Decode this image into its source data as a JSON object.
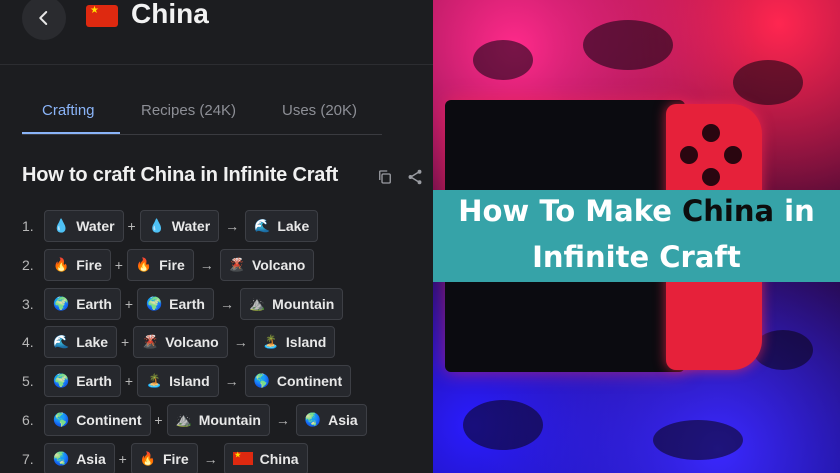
{
  "header": {
    "title": "China",
    "back_icon": "chevron-left-icon"
  },
  "tabs": [
    {
      "label": "Crafting",
      "active": true
    },
    {
      "label": "Recipes (24K)",
      "active": false
    },
    {
      "label": "Uses (20K)",
      "active": false
    }
  ],
  "section": {
    "heading": "How to craft China in Infinite Craft",
    "copy_icon": "copy-icon",
    "share_icon": "share-icon"
  },
  "steps": [
    {
      "num": "1.",
      "a": {
        "emoji": "💧",
        "label": "Water"
      },
      "b": {
        "emoji": "💧",
        "label": "Water"
      },
      "result": {
        "emoji": "🌊",
        "label": "Lake"
      }
    },
    {
      "num": "2.",
      "a": {
        "emoji": "🔥",
        "label": "Fire"
      },
      "b": {
        "emoji": "🔥",
        "label": "Fire"
      },
      "result": {
        "emoji": "🌋",
        "label": "Volcano"
      }
    },
    {
      "num": "3.",
      "a": {
        "emoji": "🌍",
        "label": "Earth"
      },
      "b": {
        "emoji": "🌍",
        "label": "Earth"
      },
      "result": {
        "emoji": "⛰️",
        "label": "Mountain"
      }
    },
    {
      "num": "4.",
      "a": {
        "emoji": "🌊",
        "label": "Lake"
      },
      "b": {
        "emoji": "🌋",
        "label": "Volcano"
      },
      "result": {
        "emoji": "🏝️",
        "label": "Island"
      }
    },
    {
      "num": "5.",
      "a": {
        "emoji": "🌍",
        "label": "Earth"
      },
      "b": {
        "emoji": "🏝️",
        "label": "Island"
      },
      "result": {
        "emoji": "🌎",
        "label": "Continent"
      }
    },
    {
      "num": "6.",
      "a": {
        "emoji": "🌎",
        "label": "Continent"
      },
      "b": {
        "emoji": "⛰️",
        "label": "Mountain"
      },
      "result": {
        "emoji": "🌏",
        "label": "Asia"
      }
    },
    {
      "num": "7.",
      "a": {
        "emoji": "🌏",
        "label": "Asia"
      },
      "b": {
        "emoji": "🔥",
        "label": "Fire"
      },
      "result": {
        "emoji": "flag",
        "label": "China"
      }
    }
  ],
  "operators": {
    "plus": "+",
    "arrow": "→"
  },
  "banner": {
    "line1_pre": "How To Make ",
    "line1_highlight": "China",
    "line1_post": " in",
    "line2": "Infinite Craft",
    "bg_color": "#36a3a8",
    "highlight_color": "#0d0d0d"
  },
  "colors": {
    "panel_bg": "#1c1d20",
    "accent": "#8ab4f8",
    "flag_red": "#de2910",
    "flag_star": "#ffde00"
  }
}
